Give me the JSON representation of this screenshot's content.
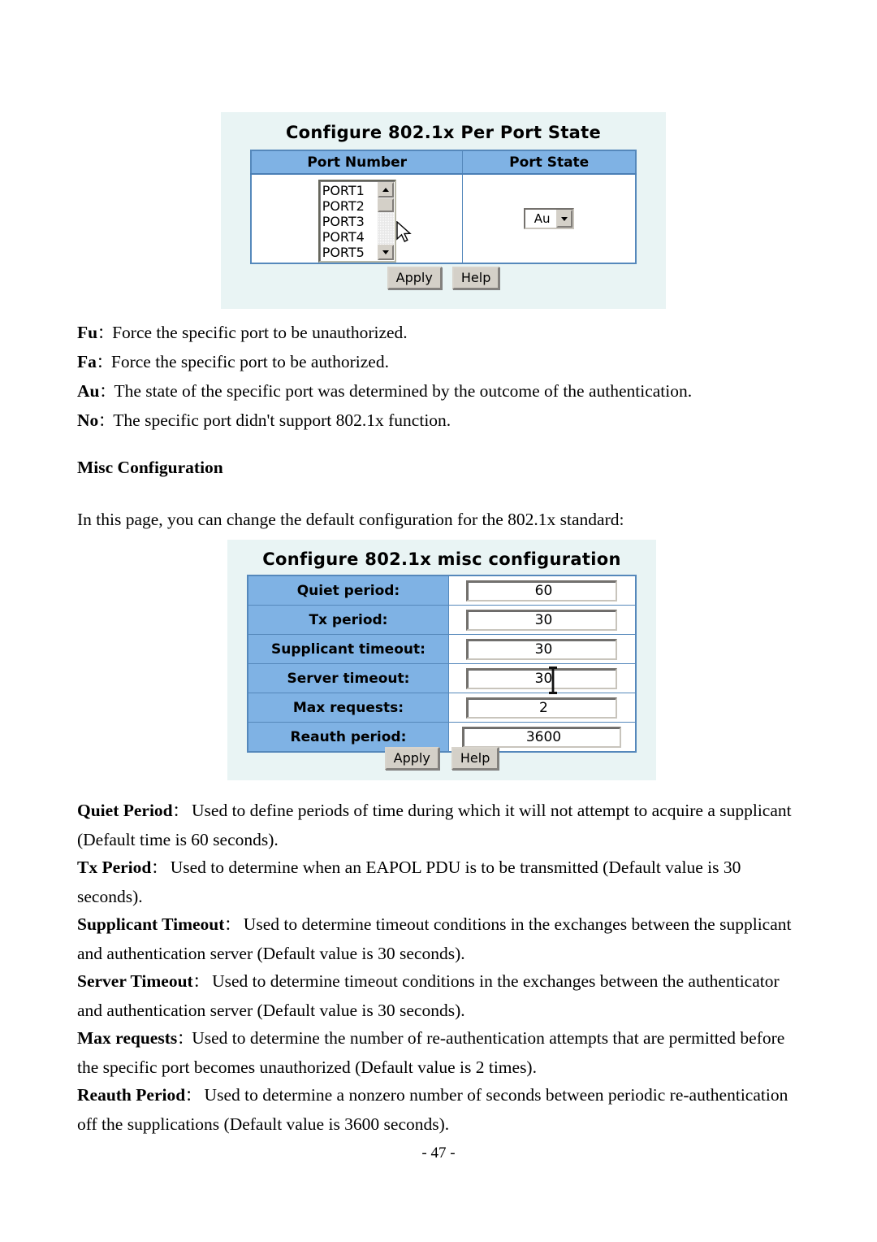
{
  "page": {
    "number_label": "- 47 -"
  },
  "panel_port_state": {
    "title": "Configure 802.1x Per Port State",
    "columns": [
      "Port Number",
      "Port State"
    ],
    "port_list": {
      "options": [
        "PORT1",
        "PORT2",
        "PORT3",
        "PORT4",
        "PORT5"
      ]
    },
    "port_state_select": {
      "value": "Au"
    },
    "buttons": {
      "apply": "Apply",
      "help": "Help"
    }
  },
  "legend": [
    {
      "term": "Fu",
      "colon": "：",
      "text": "Force the specific port to be unauthorized."
    },
    {
      "term": "Fa",
      "colon": "：",
      "text": "Force the specific port to be authorized."
    },
    {
      "term": "Au",
      "colon": "：",
      "text": "The state of the specific port was determined by the outcome of the authentication."
    },
    {
      "term": "No",
      "colon": "：",
      "text": "The specific port didn't support 802.1x function."
    }
  ],
  "misc_section": {
    "heading": "Misc Configuration",
    "intro": "In this page, you can change the default configuration for the 802.1x standard:"
  },
  "panel_misc": {
    "title": "Configure 802.1x misc configuration",
    "rows": [
      {
        "label": "Quiet period:",
        "value": "60"
      },
      {
        "label": "Tx period:",
        "value": "30"
      },
      {
        "label": "Supplicant timeout:",
        "value": "30"
      },
      {
        "label": "Server timeout:",
        "value": "30"
      },
      {
        "label": "Max requests:",
        "value": "2"
      },
      {
        "label": "Reauth period:",
        "value": "3600"
      }
    ],
    "buttons": {
      "apply": "Apply",
      "help": "Help"
    }
  },
  "descriptions": [
    {
      "term": "Quiet Period",
      "colon": "：",
      "text": " Used to define periods of time during which it will not attempt to acquire a supplicant (Default time is 60 seconds)."
    },
    {
      "term": "Tx Period",
      "colon": "：",
      "text": " Used to determine when an EAPOL PDU is to be transmitted (Default value is 30 seconds)."
    },
    {
      "term": "Supplicant Timeout",
      "colon": "：",
      "text": " Used to determine timeout conditions in the exchanges between the supplicant and authentication server (Default value is 30 seconds)."
    },
    {
      "term": "Server Timeout",
      "colon": "：",
      "text": " Used to determine timeout conditions in the exchanges between the authenticator and authentication server (Default value is 30 seconds)."
    },
    {
      "term": "Max requests",
      "colon": "：",
      "text": "Used to determine the number of re-authentication attempts that are permitted before the specific port becomes unauthorized (Default value is 2 times)."
    },
    {
      "term": "Reauth Period",
      "colon": "：",
      "text": " Used to determine a nonzero number of seconds between periodic re-authentication off the supplications (Default value is 3600 seconds)."
    }
  ]
}
